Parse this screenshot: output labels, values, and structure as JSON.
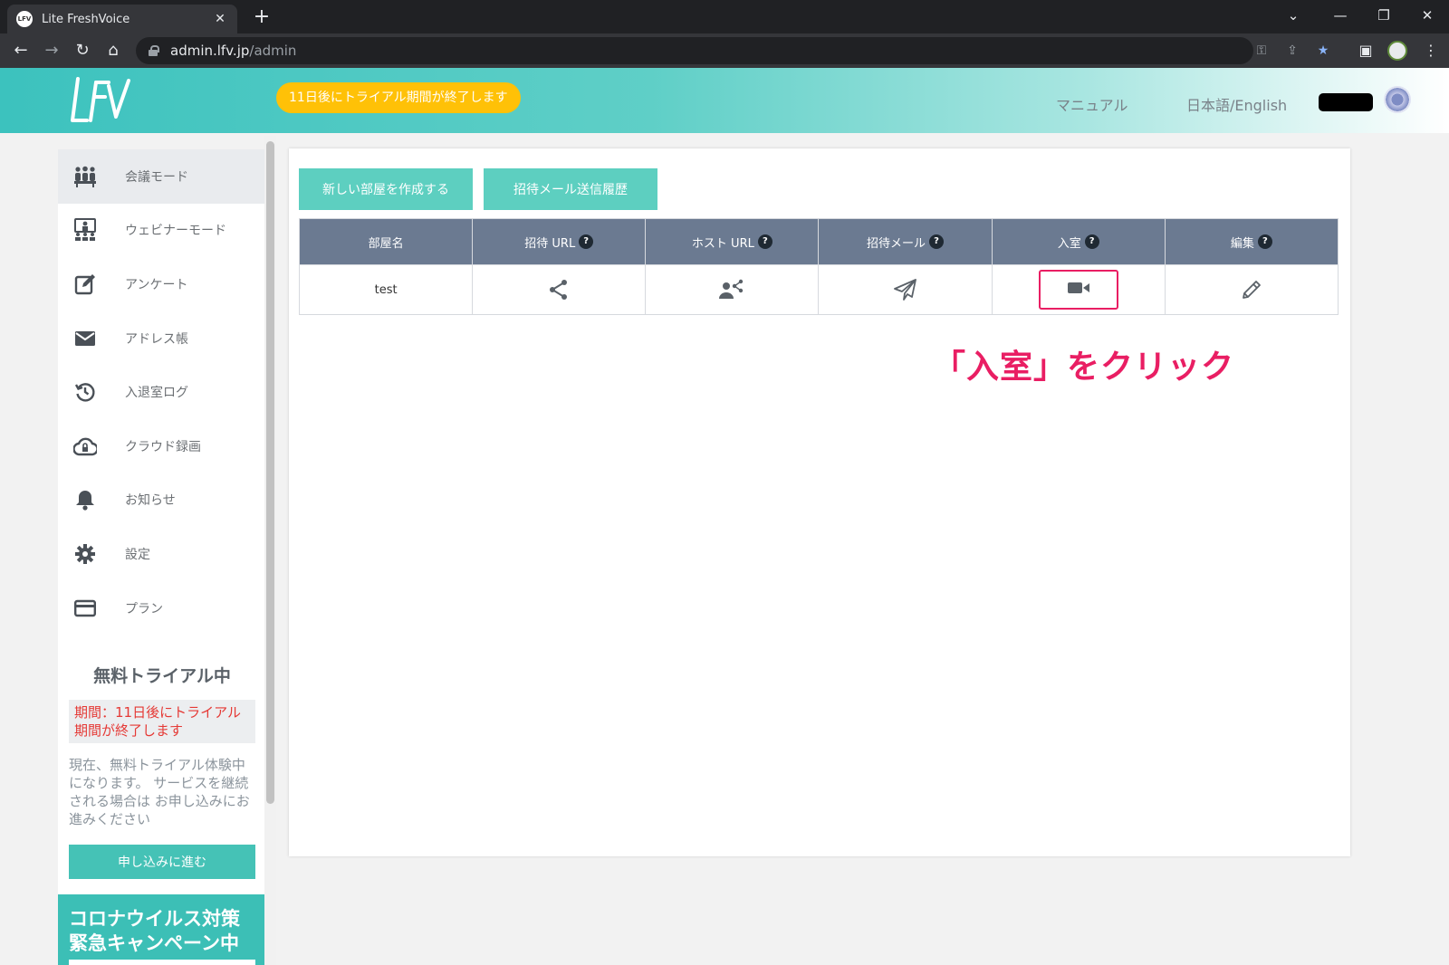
{
  "browser": {
    "tab_title": "Lite FreshVoice",
    "tab_favicon": "LFV",
    "new_tab": "+",
    "url_host": "admin.lfv.jp",
    "url_path": "/admin",
    "icons": {
      "back": "←",
      "forward": "→",
      "reload": "↻",
      "home": "⌂",
      "minimize": "—",
      "restore": "❐",
      "close": "✕",
      "tablist": "⌄",
      "key": "⚿",
      "share": "⇪",
      "star": "★",
      "sidepanel": "▣",
      "menu": "⋮",
      "tabclose": "✕"
    }
  },
  "header": {
    "trial_notice": "11日後にトライアル期間が終了します",
    "manual_link": "マニュアル",
    "language_link": "日本語/English"
  },
  "sidebar": {
    "items": [
      {
        "label": "会議モード",
        "icon": "meeting-people-icon"
      },
      {
        "label": "ウェビナーモード",
        "icon": "webinar-icon"
      },
      {
        "label": "アンケート",
        "icon": "edit-square-icon"
      },
      {
        "label": "アドレス帳",
        "icon": "mail-icon"
      },
      {
        "label": "入退室ログ",
        "icon": "history-icon"
      },
      {
        "label": "クラウド録画",
        "icon": "cloud-lock-icon"
      },
      {
        "label": "お知らせ",
        "icon": "bell-icon"
      },
      {
        "label": "設定",
        "icon": "gear-icon"
      },
      {
        "label": "プラン",
        "icon": "credit-card-icon"
      }
    ],
    "trial": {
      "title": "無料トライアル中",
      "period": "期間：11日後にトライアル期間が終了します",
      "description": "現在、無料トライアル体験中 になります。 サービスを継続される場合は お申し込みにお進みください",
      "apply_button": "申し込みに進む"
    },
    "campaign": "コロナウイルス対策緊急キャンペーン中"
  },
  "main": {
    "create_room_button": "新しい部屋を作成する",
    "invite_history_button": "招待メール送信履歴",
    "table": {
      "headers": [
        "部屋名",
        "招待 URL",
        "ホスト URL",
        "招待メール",
        "入室",
        "編集"
      ],
      "help_mark": "?",
      "rows": [
        {
          "room_name": "test"
        }
      ]
    },
    "annotation": "「入室」をクリック"
  },
  "colors": {
    "accent": "#3cc2be",
    "highlight": "#e91e63",
    "trial_pill": "#ffc107",
    "table_header": "#6b7a91"
  }
}
